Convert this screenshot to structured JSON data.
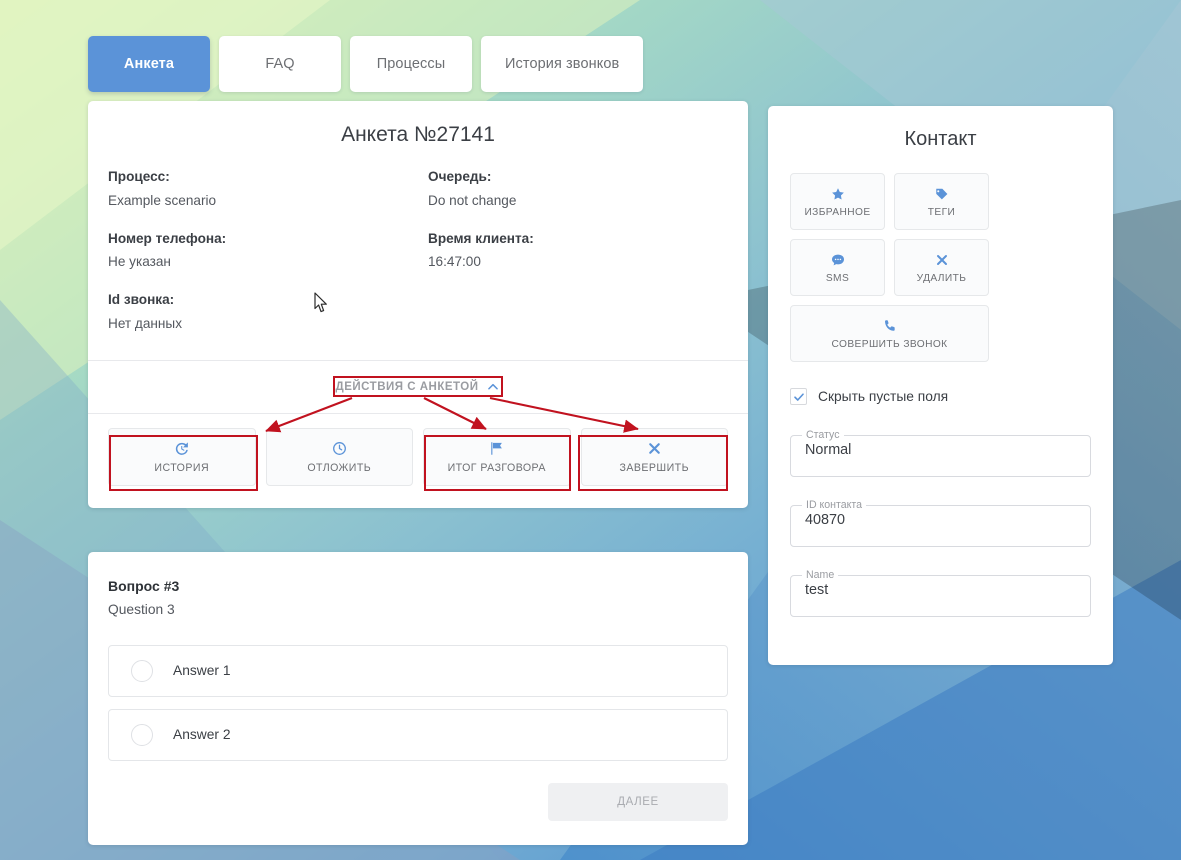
{
  "theme": {
    "accent": "#5b93d8",
    "annotation_red": "#c1121f",
    "card_bg": "#ffffff",
    "muted_text": "#6d6f73"
  },
  "tabs": [
    {
      "label": "Анкета",
      "active": true
    },
    {
      "label": "FAQ",
      "active": false
    },
    {
      "label": "Процессы",
      "active": false
    },
    {
      "label": "История звонков",
      "active": false
    }
  ],
  "anketa": {
    "title": "Анкета №27141",
    "fields": [
      {
        "label": "Процесс:",
        "value": "Example scenario"
      },
      {
        "label": "Очередь:",
        "value": "Do not change"
      },
      {
        "label": "Номер телефона:",
        "value": "Не указан"
      },
      {
        "label": "Время клиента:",
        "value": "16:47:00"
      },
      {
        "label": "Id звонка:",
        "value": "Нет данных"
      }
    ],
    "collapse_label": "ДЕЙСТВИЯ С АНКЕТОЙ",
    "collapse_icon": "chevron-up-icon",
    "actions": [
      {
        "label": "ИСТОРИЯ",
        "icon": "history-icon",
        "highlighted": true
      },
      {
        "label": "ОТЛОЖИТЬ",
        "icon": "clock-icon",
        "highlighted": false
      },
      {
        "label": "ИТОГ РАЗГОВОРА",
        "icon": "flag-icon",
        "highlighted": true
      },
      {
        "label": "ЗАВЕРШИТЬ",
        "icon": "close-x-icon",
        "highlighted": true
      }
    ]
  },
  "question": {
    "number_label": "Вопрос #3",
    "text": "Question 3",
    "answers": [
      {
        "label": "Answer 1",
        "selected": false
      },
      {
        "label": "Answer 2",
        "selected": false
      }
    ],
    "next_label": "ДАЛЕЕ"
  },
  "contact": {
    "title": "Контакт",
    "buttons": [
      {
        "label": "ИЗБРАННОЕ",
        "icon": "star-icon",
        "width": "small"
      },
      {
        "label": "ТЕГИ",
        "icon": "tag-icon",
        "width": "small"
      },
      {
        "label": "SMS",
        "icon": "speech-bubble-icon",
        "width": "small"
      },
      {
        "label": "УДАЛИТЬ",
        "icon": "close-x-icon",
        "width": "small"
      },
      {
        "label": "СОВЕРШИТЬ ЗВОНОК",
        "icon": "phone-icon",
        "width": "wide"
      }
    ],
    "checkbox": {
      "label": "Скрыть пустые поля",
      "checked": true
    },
    "fields": [
      {
        "label": "Статус",
        "value": "Normal"
      },
      {
        "label": "ID контакта",
        "value": "40870"
      },
      {
        "label": "Name",
        "value": "test"
      }
    ]
  }
}
